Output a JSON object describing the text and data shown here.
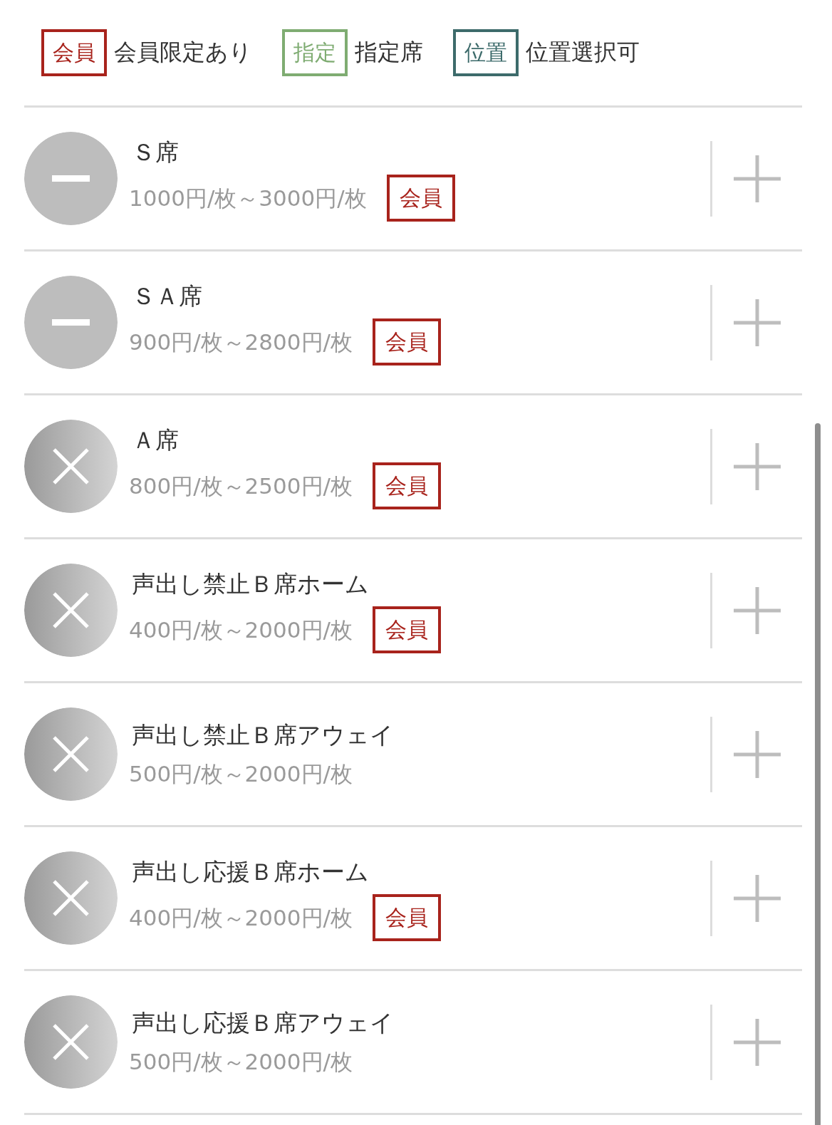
{
  "legend": [
    {
      "badge": "会員",
      "text": "会員限定あり",
      "color": "#a8231c"
    },
    {
      "badge": "指定",
      "text": "指定席",
      "color": "#7fac72"
    },
    {
      "badge": "位置",
      "text": "位置選択可",
      "color": "#3d6b6b"
    }
  ],
  "seats": [
    {
      "kind": "minus",
      "name": "Ｓ席",
      "price": "1000円/枚～3000円/枚",
      "badge": "会員"
    },
    {
      "kind": "minus",
      "name": "ＳＡ席",
      "price": "900円/枚～2800円/枚",
      "badge": "会員"
    },
    {
      "kind": "cross",
      "name": "Ａ席",
      "price": "800円/枚～2500円/枚",
      "badge": "会員"
    },
    {
      "kind": "cross",
      "name": "声出し禁止Ｂ席ホーム",
      "price": "400円/枚～2000円/枚",
      "badge": "会員"
    },
    {
      "kind": "cross",
      "name": "声出し禁止Ｂ席アウェイ",
      "price": "500円/枚～2000円/枚"
    },
    {
      "kind": "cross",
      "name": "声出し応援Ｂ席ホーム",
      "price": "400円/枚～2000円/枚",
      "badge": "会員"
    },
    {
      "kind": "cross",
      "name": "声出し応援Ｂ席アウェイ",
      "price": "500円/枚～2000円/枚"
    }
  ]
}
